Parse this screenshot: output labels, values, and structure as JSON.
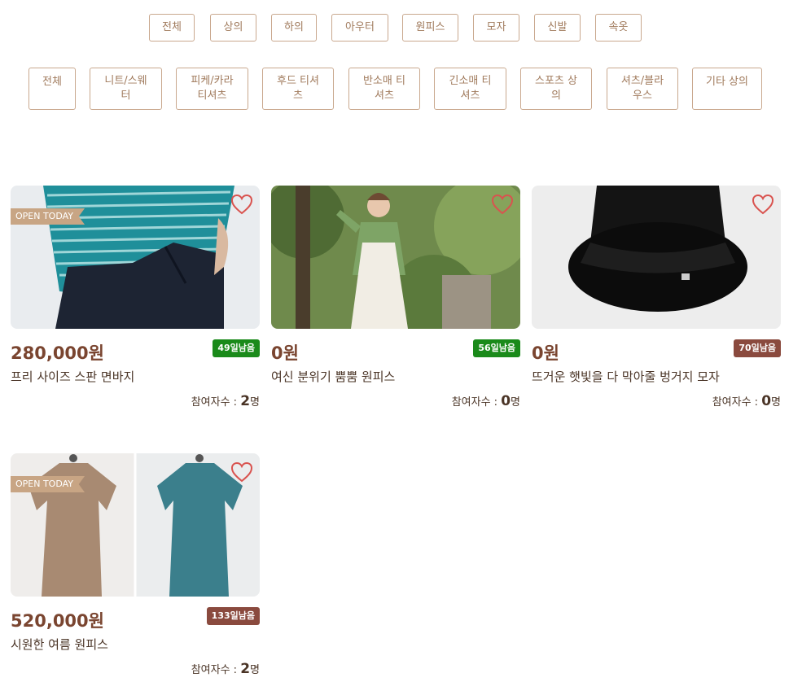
{
  "categories_main": [
    "전체",
    "상의",
    "하의",
    "아우터",
    "원피스",
    "모자",
    "신발",
    "속옷"
  ],
  "categories_sub": [
    [
      "전체"
    ],
    [
      "니트/스웨",
      "터"
    ],
    [
      "피케/카라",
      "티셔츠"
    ],
    [
      "후드 티셔",
      "츠"
    ],
    [
      "반소매 티",
      "셔츠"
    ],
    [
      "긴소매 티",
      "셔츠"
    ],
    [
      "스포츠 상",
      "의"
    ],
    [
      "셔츠/블라",
      "우스"
    ],
    [
      "기타 상의"
    ]
  ],
  "colors": {
    "accent": "#c9a88e",
    "price": "#7a4530",
    "dday_green": "#1a8a1a",
    "dday_brown": "#8a4a3e",
    "heart": "#d9534f",
    "ribbon": "#c8a584"
  },
  "products": [
    {
      "price": "280,000원",
      "dday": "49일남음",
      "dday_color": "#1a8a1a",
      "name": "프리 사이즈 스판 면바지",
      "participants_label": "참여자수 : ",
      "participants_count": "2",
      "participants_unit": "명",
      "ribbon": "OPEN TODAY",
      "image": "pants-striped-shirt"
    },
    {
      "price": "0원",
      "dday": "56일남음",
      "dday_color": "#1a8a1a",
      "name": "여신 분위기 뿜뿜 원피스",
      "participants_label": "참여자수 : ",
      "participants_count": "0",
      "participants_unit": "명",
      "ribbon": "",
      "image": "woman-garden-dress"
    },
    {
      "price": "0원",
      "dday": "70일남음",
      "dday_color": "#8a4a3e",
      "name": "뜨거운 햇빛을 다 막아줄 벙거지 모자",
      "participants_label": "참여자수 : ",
      "participants_count": "0",
      "participants_unit": "명",
      "ribbon": "",
      "image": "black-bucket-hat"
    },
    {
      "price": "520,000원",
      "dday": "133일남음",
      "dday_color": "#8a4a3e",
      "name": "시원한 여름 원피스",
      "participants_label": "참여자수 : ",
      "participants_count": "2",
      "participants_unit": "명",
      "ribbon": "OPEN TODAY",
      "image": "linen-dresses-pair"
    }
  ]
}
